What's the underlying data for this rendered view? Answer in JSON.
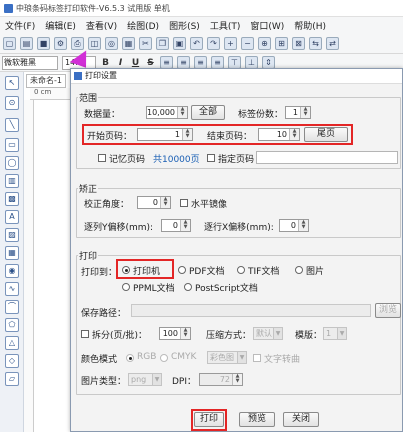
{
  "app": {
    "title": "中琅条码标签打印软件-V6.5.3 试用版 单机"
  },
  "menu": [
    "文件(F)",
    "编辑(E)",
    "查看(V)",
    "绘图(D)",
    "图形(S)",
    "工具(T)",
    "窗口(W)",
    "帮助(H)"
  ],
  "format": {
    "font": "微软雅黑",
    "size": "14.0",
    "bold": "B",
    "italic": "I",
    "underline": "U",
    "strike": "S"
  },
  "doc": {
    "tab": "未命名-1",
    "ruler_unit": "0 cm"
  },
  "left_tools": [
    "pointer-icon",
    "zoom-icon",
    "line-icon",
    "rect-icon",
    "ellipse-icon",
    "barcode-icon",
    "qrcode-icon",
    "text-icon",
    "image-icon",
    "table-icon",
    "db-icon",
    "curve-icon",
    "arc-icon",
    "poly-icon",
    "triangle-icon",
    "diamond-icon"
  ],
  "dialog": {
    "title": "打印设置",
    "range": {
      "label": "范围",
      "data_qty_label": "数据量：",
      "data_qty_value": "10,000",
      "all_button": "全部",
      "copies_label": "标签份数：",
      "copies_value": "1",
      "start_page_label": "开始页码：",
      "start_page_value": "1",
      "end_page_label": "结束页码：",
      "end_page_value": "10",
      "last_page_button": "尾页",
      "remember_label": "记忆页码",
      "total_pages": "共10000页",
      "specific_label": "指定页码"
    },
    "correction": {
      "label": "矫正",
      "angle_label": "校正角度：",
      "angle_value": "0",
      "mirror_label": "水平镜像",
      "y_offset_label": "逐列Y偏移(mm):",
      "y_offset_value": "0",
      "x_offset_label": "逐行X偏移(mm):",
      "x_offset_value": "0"
    },
    "print": {
      "label": "打印",
      "to_label": "打印到：",
      "options": [
        "打印机",
        "PDF文档",
        "TIF文档",
        "图片",
        "PPML文档",
        "PostScript文档"
      ],
      "selected": "打印机",
      "save_path_label": "保存路径：",
      "browse_button": "浏览",
      "split_label": "拆分(页/批)：",
      "split_value": "100",
      "compress_label": "压缩方式：",
      "compress_value": "默认",
      "mode_label": "模版：",
      "mode_value": "1",
      "color_mode_label": "颜色模式",
      "color_options": [
        "RGB",
        "CMYK"
      ],
      "color_depth": "彩色图",
      "text_convert_label": "文字转曲",
      "image_type_label": "图片类型：",
      "image_type_value": "png",
      "dpi_label": "DPI：",
      "dpi_value": "72"
    },
    "buttons": {
      "print": "打印",
      "preview": "预览",
      "close": "关闭"
    }
  },
  "colors": {
    "highlight": "#e32626",
    "arrow": "#d12fd6",
    "link": "#1a5fb4"
  }
}
